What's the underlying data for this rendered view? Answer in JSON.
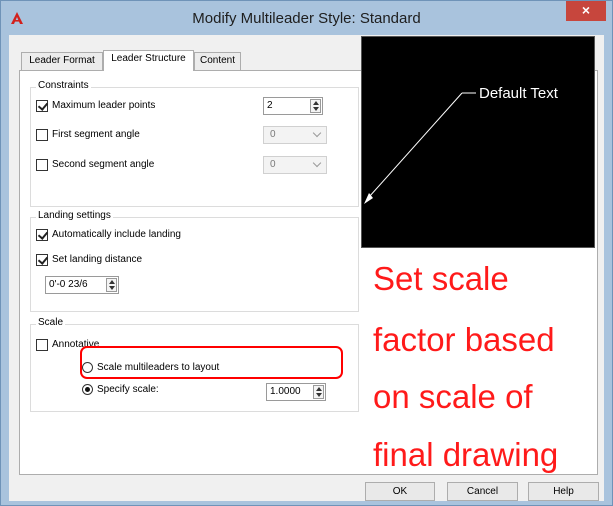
{
  "window": {
    "title": "Modify Multileader Style: Standard",
    "close_label": "×"
  },
  "tabs": [
    {
      "label": "Leader Format",
      "active": false
    },
    {
      "label": "Leader Structure",
      "active": true
    },
    {
      "label": "Content",
      "active": false
    }
  ],
  "constraints": {
    "title": "Constraints",
    "max_leader_points": {
      "label": "Maximum leader points",
      "checked": true,
      "value": "2"
    },
    "first_segment_angle": {
      "label": "First segment angle",
      "checked": false,
      "value": "0"
    },
    "second_segment_angle": {
      "label": "Second segment angle",
      "checked": false,
      "value": "0"
    }
  },
  "landing": {
    "title": "Landing settings",
    "auto_include_landing": {
      "label": "Automatically include landing",
      "checked": true
    },
    "set_landing_distance": {
      "label": "Set landing distance",
      "checked": true
    },
    "distance_value": "0'-0 23/6"
  },
  "scale": {
    "title": "Scale",
    "annotative": {
      "label": "Annotative",
      "checked": false
    },
    "scale_to_layout": {
      "label": "Scale multileaders to layout",
      "selected": false
    },
    "specify_scale": {
      "label": "Specify scale:",
      "selected": true,
      "value": "1.0000"
    }
  },
  "preview": {
    "text": "Default Text",
    "background": "#000000",
    "line_color": "#ffffff"
  },
  "annotation": {
    "lines": [
      "Set scale",
      "factor based",
      "on scale of",
      "final drawing"
    ],
    "color": "#ff0000"
  },
  "buttons": {
    "ok": "OK",
    "cancel": "Cancel",
    "help": "Help"
  },
  "icons": {
    "app": "autocad-logo-icon",
    "close": "close-icon",
    "checkbox": "check-icon",
    "spinner": "spinner-arrows-icon",
    "dropdown": "chevron-down-icon",
    "radio": "radio-dot-icon"
  }
}
